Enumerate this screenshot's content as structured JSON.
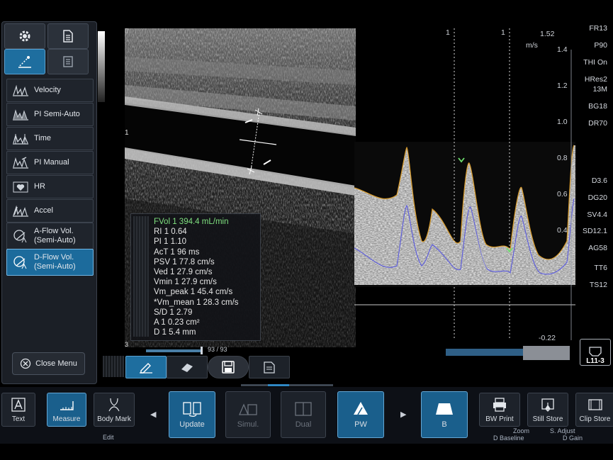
{
  "bmode": {
    "depth_marker": "1",
    "frame_counter": "93 / 93",
    "bottom_marker": "3"
  },
  "menu": {
    "tabs": [
      {
        "icon": "gear-icon"
      },
      {
        "icon": "document-icon"
      },
      {
        "icon": "measure-tool-icon"
      },
      {
        "icon": "report-icon"
      }
    ],
    "items": [
      {
        "label": "Velocity"
      },
      {
        "label": "PI Semi-Auto"
      },
      {
        "label": "Time"
      },
      {
        "label": "PI Manual"
      },
      {
        "label": "HR"
      },
      {
        "label": "Accel"
      },
      {
        "label": "A-Flow Vol.\n(Semi-Auto)"
      },
      {
        "label": "D-Flow Vol.\n(Semi-Auto)"
      }
    ],
    "close_label": "Close Menu"
  },
  "measurements": [
    {
      "text": "FVol 1  394.4  mL/min",
      "highlight": true
    },
    {
      "text": "RI 1  0.64"
    },
    {
      "text": "PI 1  1.10"
    },
    {
      "text": "AcT 1  96 ms"
    },
    {
      "text": "PSV 1  77.8 cm/s"
    },
    {
      "text": "Ved 1  27.9 cm/s"
    },
    {
      "text": "Vmin 1  27.9 cm/s"
    },
    {
      "text": "Vm_peak 1  45.4 cm/s"
    },
    {
      "text": "*Vm_mean 1  28.3 cm/s"
    },
    {
      "text": "S/D 1  2.79"
    },
    {
      "text": "A 1  0.23 cm²"
    },
    {
      "text": "D 1  5.4 mm"
    }
  ],
  "doppler": {
    "unit": "m/s",
    "max_label": "1.52",
    "min_label": "-0.22",
    "cursor_label": "1",
    "scale": [
      "1.4",
      "1.2",
      "1.0",
      "0.8",
      "0.6",
      "0.4"
    ],
    "params": [
      "FR13",
      "P90",
      "THI On",
      "HRes2",
      "13M",
      "BG18",
      "DR70",
      "D3.6",
      "DG20",
      "SV4.4",
      "SD12.1",
      "AG58",
      "TT6",
      "TS12"
    ],
    "probe": "L11-3"
  },
  "toolbar": {
    "text_label": "Text",
    "measure_label": "Measure",
    "body_mark_label": "Body Mark",
    "edit_label": "Edit",
    "update_label": "Update",
    "simul_label": "Simul.",
    "dual_label": "Dual",
    "pw_label": "PW",
    "b_label": "B",
    "bw_print_label": "BW Print",
    "still_store_label": "Still Store",
    "clip_store_label": "Clip Store",
    "zoom_label": "Zoom",
    "s_adjust_label": "S. Adjust",
    "d_baseline_label": "D Baseline",
    "d_gain_label": "D Gain"
  }
}
